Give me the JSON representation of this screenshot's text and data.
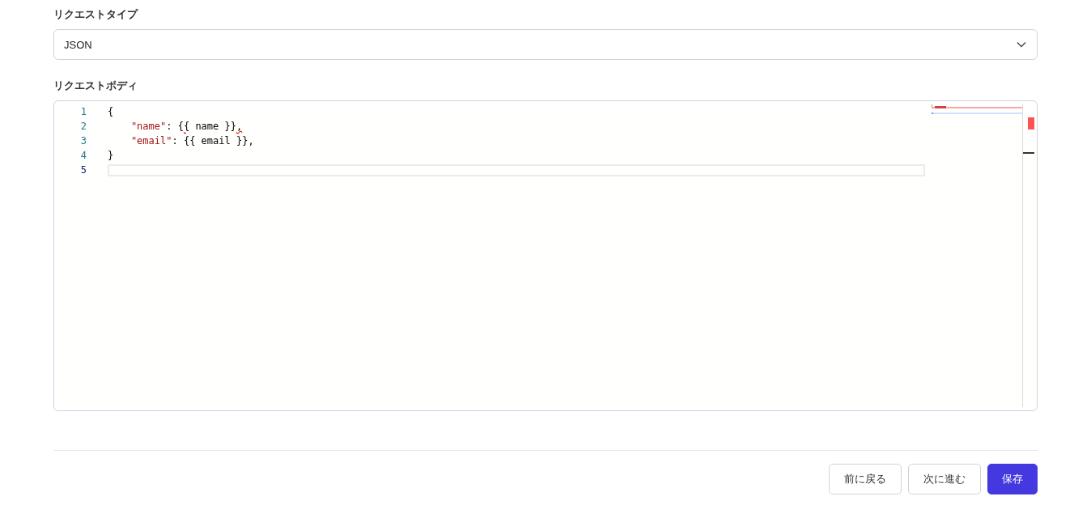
{
  "request_type": {
    "label": "リクエストタイプ",
    "value": "JSON"
  },
  "request_body": {
    "label": "リクエストボディ",
    "lines": [
      {
        "number": "1",
        "active": false,
        "tokens": [
          {
            "text": "{",
            "kind": "plain"
          }
        ]
      },
      {
        "number": "2",
        "active": false,
        "tokens": [
          {
            "text": "    \"name\"",
            "kind": "key"
          },
          {
            "text": ": {",
            "kind": "plain"
          },
          {
            "text": "{",
            "kind": "error"
          },
          {
            "text": " name }}",
            "kind": "plain"
          },
          {
            "text": ",",
            "kind": "error"
          }
        ]
      },
      {
        "number": "3",
        "active": false,
        "tokens": [
          {
            "text": "    \"email\"",
            "kind": "key"
          },
          {
            "text": ": {{ email }},",
            "kind": "plain"
          }
        ]
      },
      {
        "number": "4",
        "active": false,
        "tokens": [
          {
            "text": "}",
            "kind": "plain"
          }
        ]
      },
      {
        "number": "5",
        "active": true
      }
    ]
  },
  "buttons": [
    {
      "label": "前に戻る",
      "kind": "secondary"
    },
    {
      "label": "次に進む",
      "kind": "secondary"
    },
    {
      "label": "保存",
      "kind": "primary"
    }
  ]
}
